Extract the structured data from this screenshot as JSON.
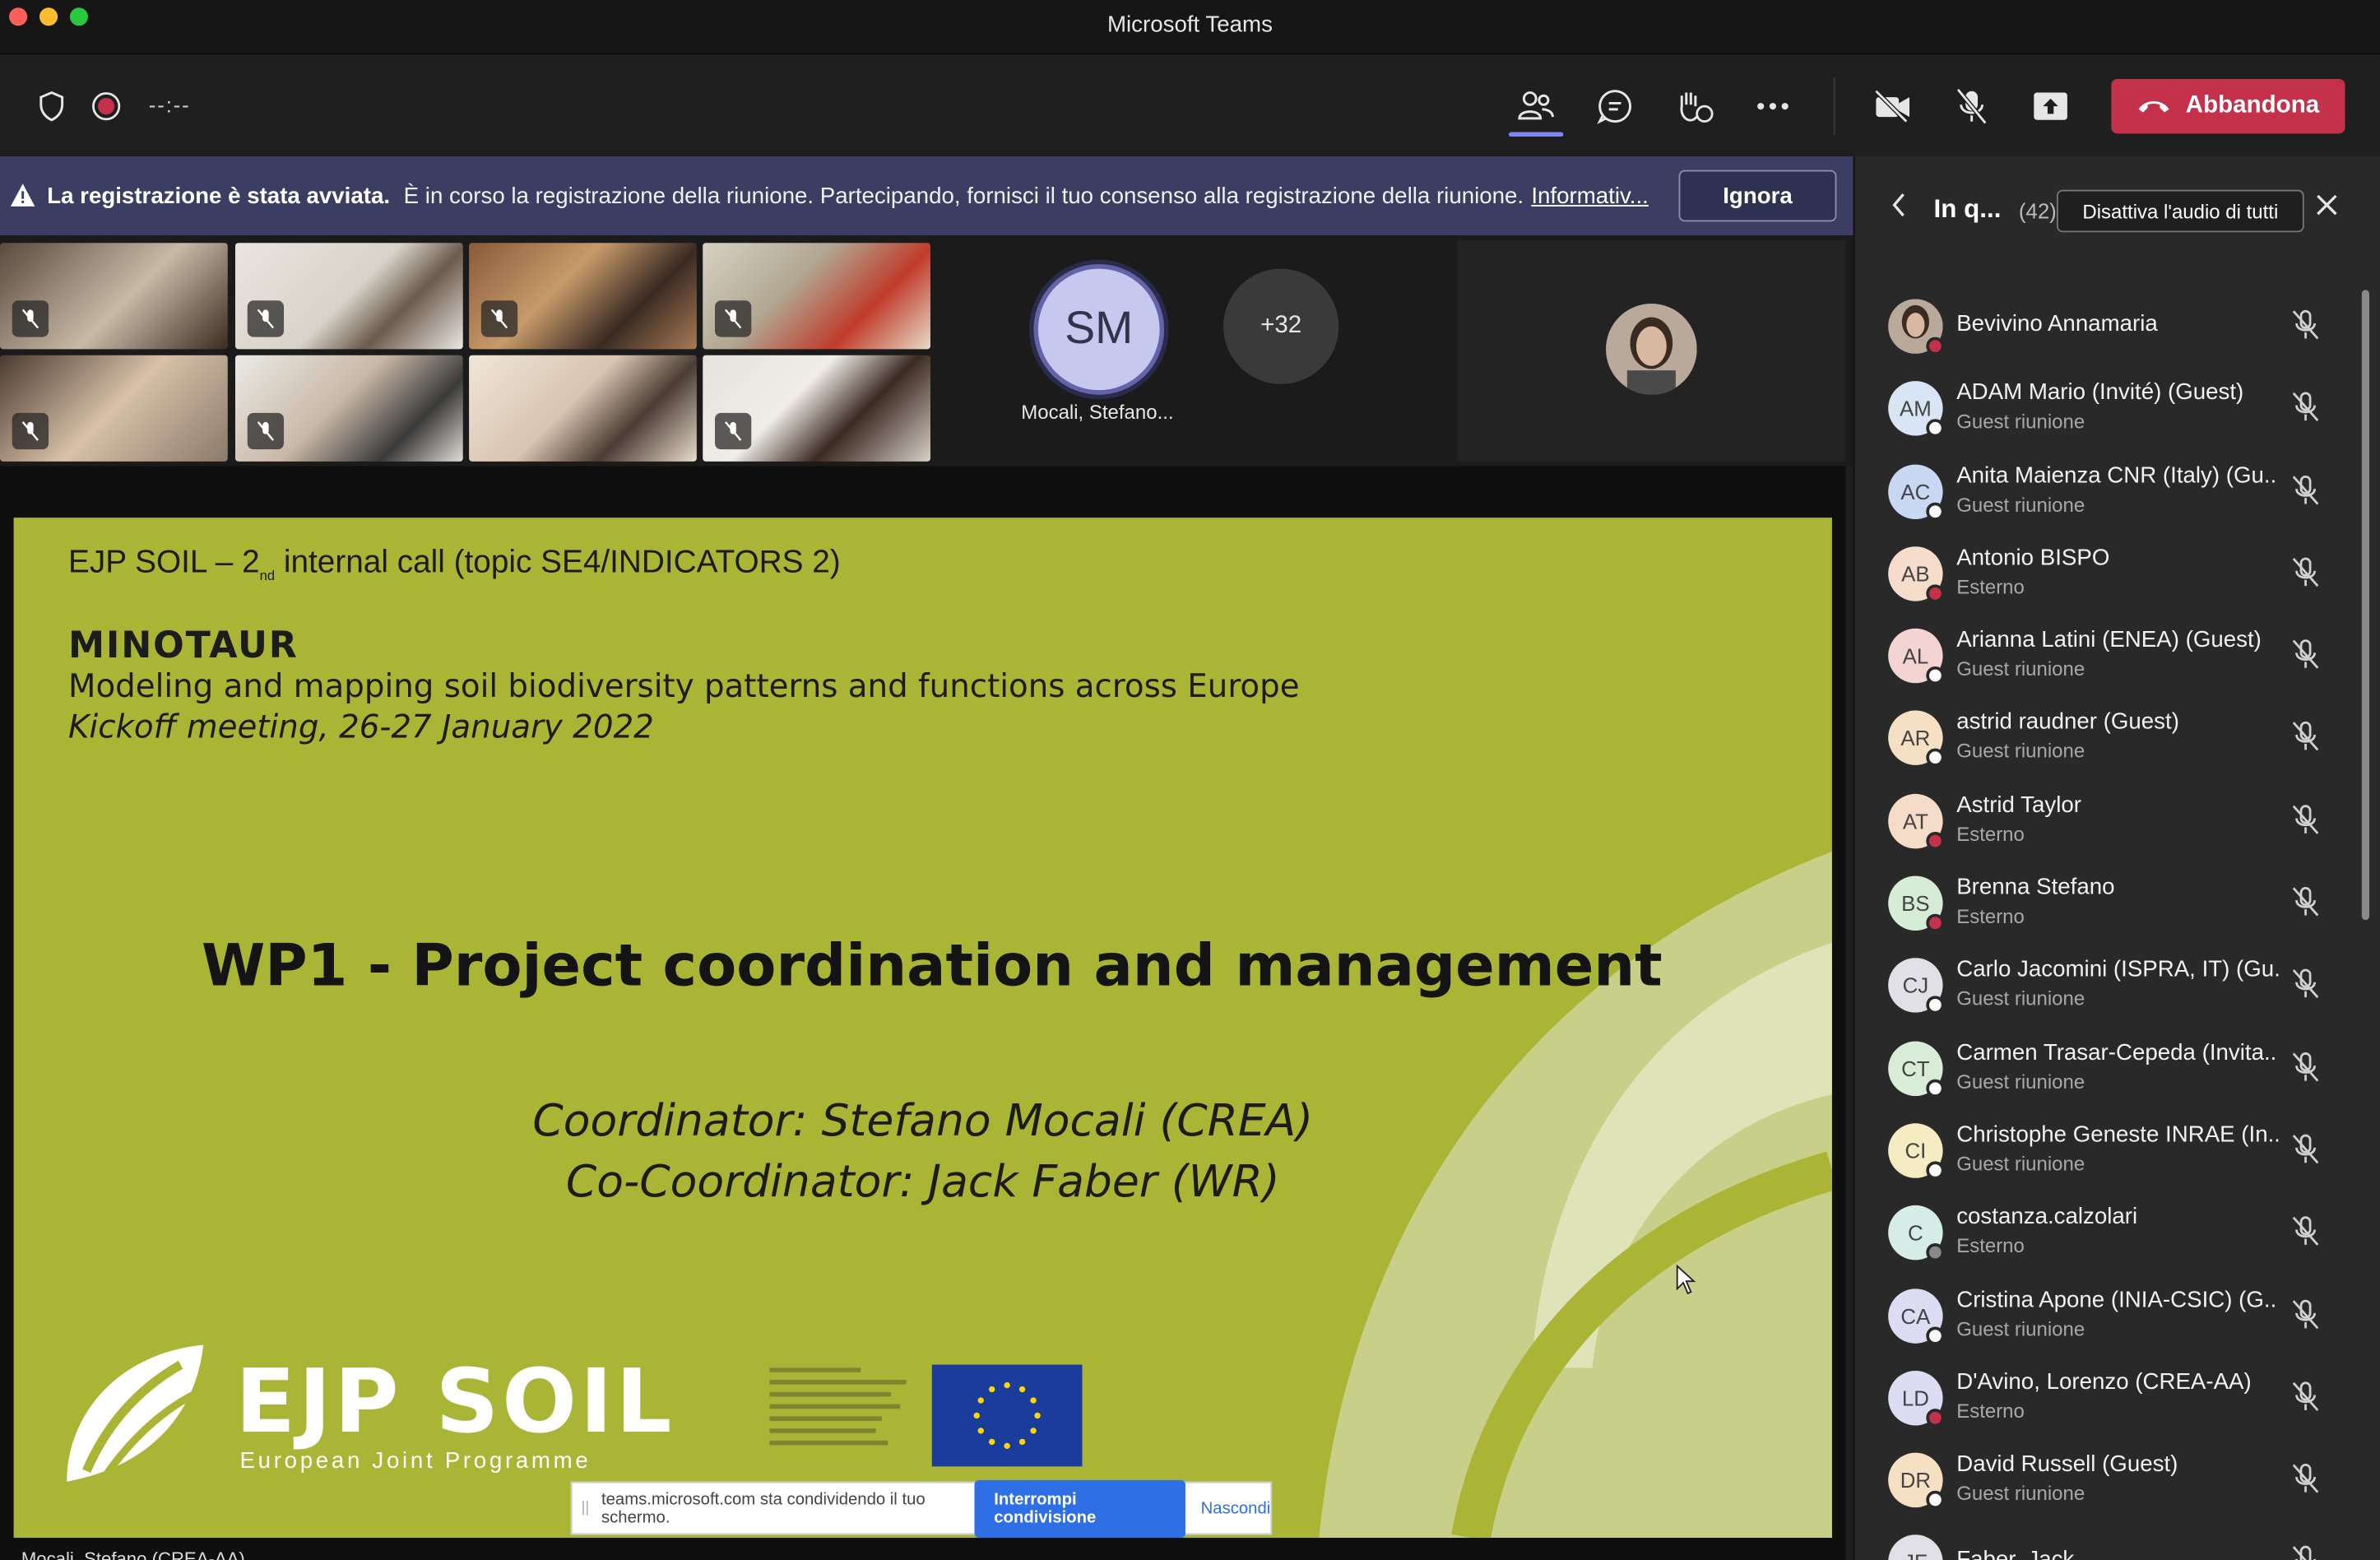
{
  "window": {
    "title": "Microsoft Teams"
  },
  "toolbar": {
    "timer": "--:--",
    "leave_label": "Abbandona"
  },
  "banner": {
    "bold": "La registrazione è stata avviata.",
    "message": "È in corso la registrazione della riunione. Partecipando, fornisci il tuo consenso alla registrazione della riunione.",
    "link": "Informativ...",
    "ignore_label": "Ignora"
  },
  "gallery": {
    "initials": "SM",
    "name": "Mocali, Stefano...",
    "overflow": "+32"
  },
  "slide": {
    "line1_a": "EJP SOIL – 2",
    "line1_sub": "nd",
    "line1_b": " internal call (topic SE4/INDICATORS 2)",
    "project": "MINOTAUR",
    "subtitle": "Modeling and mapping soil biodiversity patterns and functions across Europe",
    "meeting": "Kickoff meeting, 26-27 January 2022",
    "wp": "WP1 - Project coordination and management",
    "coordinator": "Coordinator: Stefano Mocali (CREA)",
    "cocoordinator": "Co-Coordinator: Jack Faber (WR)",
    "logo_text": "EJP SOIL",
    "logo_sub": "European Joint Programme"
  },
  "sharebar": {
    "text": "teams.microsoft.com sta condividendo il tuo schermo.",
    "stop": "Interrompi condivisione",
    "hide": "Nascondi"
  },
  "presenter_label": "Mocali, Stefano (CREA-AA)",
  "panel": {
    "title": "In q...",
    "count": "(42)",
    "mute_all": "Disattiva l'audio di tutti",
    "participants": [
      {
        "initials": "",
        "name": "Bevivino Annamaria",
        "role": "",
        "color": "#8a6a5a",
        "status": "#c4314b"
      },
      {
        "initials": "AM",
        "name": "ADAM Mario (Invité) (Guest)",
        "role": "Guest riunione",
        "color": "#d9e4f5",
        "status": "#ffffff"
      },
      {
        "initials": "AC",
        "name": "Anita Maienza CNR (Italy) (Gu...",
        "role": "Guest riunione",
        "color": "#c9d8f2",
        "status": "#ffffff"
      },
      {
        "initials": "AB",
        "name": "Antonio BISPO",
        "role": "Esterno",
        "color": "#f5dccb",
        "status": "#c4314b"
      },
      {
        "initials": "AL",
        "name": "Arianna Latini (ENEA) (Guest)",
        "role": "Guest riunione",
        "color": "#f4d3d3",
        "status": "#ffffff"
      },
      {
        "initials": "AR",
        "name": "astrid raudner (Guest)",
        "role": "Guest riunione",
        "color": "#f5e0c4",
        "status": "#ffffff"
      },
      {
        "initials": "AT",
        "name": "Astrid Taylor",
        "role": "Esterno",
        "color": "#f5dcc9",
        "status": "#c4314b"
      },
      {
        "initials": "BS",
        "name": "Brenna Stefano",
        "role": "Esterno",
        "color": "#d6ecd6",
        "status": "#c4314b"
      },
      {
        "initials": "CJ",
        "name": "Carlo Jacomini (ISPRA, IT) (Gu...",
        "role": "Guest riunione",
        "color": "#e0e0e6",
        "status": "#ffffff"
      },
      {
        "initials": "CT",
        "name": "Carmen Trasar-Cepeda (Invita...",
        "role": "Guest riunione",
        "color": "#d8ecd8",
        "status": "#ffffff"
      },
      {
        "initials": "CI",
        "name": "Christophe Geneste INRAE (In...",
        "role": "Guest riunione",
        "color": "#f5ecc4",
        "status": "#ffffff"
      },
      {
        "initials": "C",
        "name": "costanza.calzolari",
        "role": "Esterno",
        "color": "#d6ece6",
        "status": "#888888"
      },
      {
        "initials": "CA",
        "name": "Cristina Apone (INIA-CSIC) (G...",
        "role": "Guest riunione",
        "color": "#dcdcf2",
        "status": "#ffffff"
      },
      {
        "initials": "LD",
        "name": "D'Avino, Lorenzo (CREA-AA)",
        "role": "Esterno",
        "color": "#dcdcf2",
        "status": "#c4314b"
      },
      {
        "initials": "DR",
        "name": "David Russell (Guest)",
        "role": "Guest riunione",
        "color": "#f5e0c4",
        "status": "#ffffff"
      },
      {
        "initials": "JF",
        "name": "Faber, Jack",
        "role": "",
        "color": "#e0e0e6",
        "status": "#ffffff"
      }
    ]
  },
  "colors": {
    "accent": "#6264a7",
    "leave": "#c4314b",
    "banner": "#3b3d63",
    "slide_bg": "#aab536"
  }
}
